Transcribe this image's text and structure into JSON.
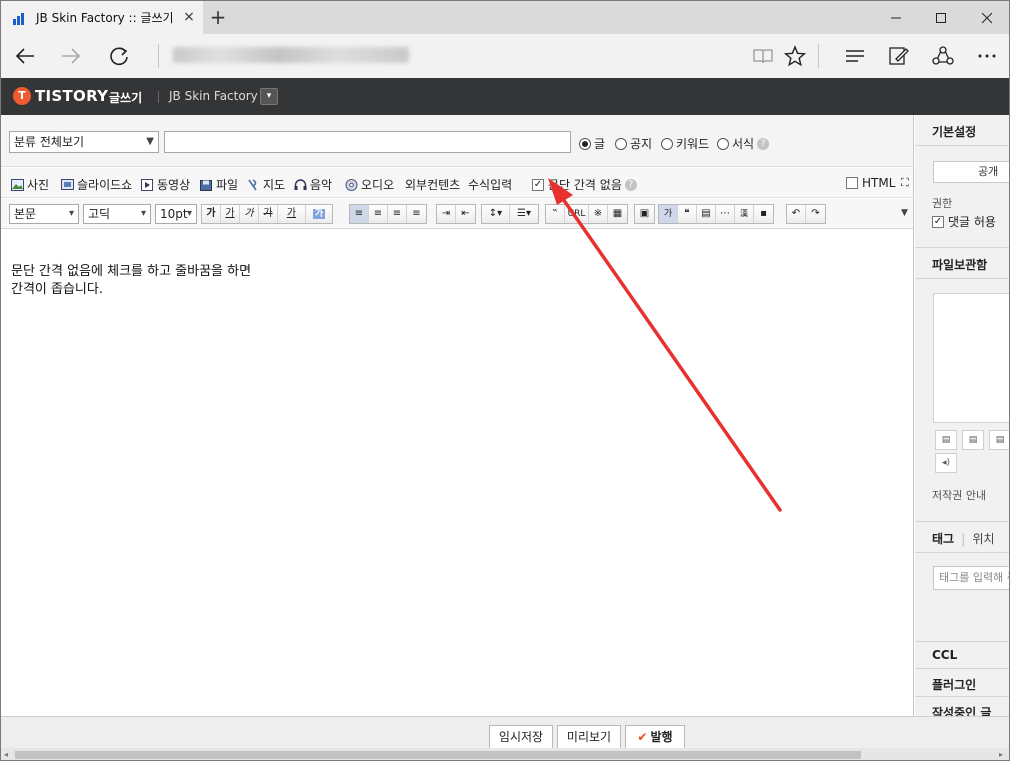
{
  "browser": {
    "tab_title": "JB Skin Factory :: 글쓰기",
    "tab_close": "×",
    "new_tab": "+"
  },
  "header": {
    "logo_mark": "T",
    "logo": "TISTORY",
    "subtitle": "글쓰기",
    "blog_name": "JB Skin Factory",
    "blog_caret": "▾"
  },
  "editor": {
    "category_select": "분류 전체보기",
    "title_value": "",
    "post_types": [
      "글",
      "공지",
      "키워드",
      "서식"
    ],
    "selected_type": "글",
    "help_mark": "?",
    "attachments": [
      "사진",
      "슬라이드쇼",
      "동영상",
      "파일",
      "지도",
      "음악",
      "오디오",
      "외부컨텐츠",
      "수식입력"
    ],
    "paragraph_option": "문단 간격 없음",
    "paragraph_checked": "✓",
    "html_label": "HTML",
    "expand_icon": "⛶",
    "format_select": "본문",
    "font_select": "고딕",
    "size_select": "10pt",
    "format_buttons": [
      "가",
      "가",
      "가",
      "가",
      "가"
    ],
    "url_label": "URL",
    "body_lines": [
      "문단 간격 없음에 체크를 하고 줄바꿈을 하면",
      "간격이 좁습니다."
    ]
  },
  "side": {
    "basic_settings": "기본설정",
    "visibility": "공개",
    "permission_label": "권한",
    "comment_allow": "댓글 허용",
    "file_storage": "파일보관함",
    "copyright": "저작권 안내",
    "tag_tab": "태그",
    "location_tab": "위치",
    "tag_placeholder": "태그를 입력해 주세요",
    "ccl": "CCL",
    "plugin": "플러그인",
    "drafts": "작성중인 글"
  },
  "bottom": {
    "save_draft": "임시저장",
    "preview": "미리보기",
    "publish": "발행",
    "publish_mark": "✔"
  },
  "colors": {
    "header_bg": "#333537",
    "brand": "#ef5a2f",
    "annotation_arrow": "#e8302e"
  }
}
